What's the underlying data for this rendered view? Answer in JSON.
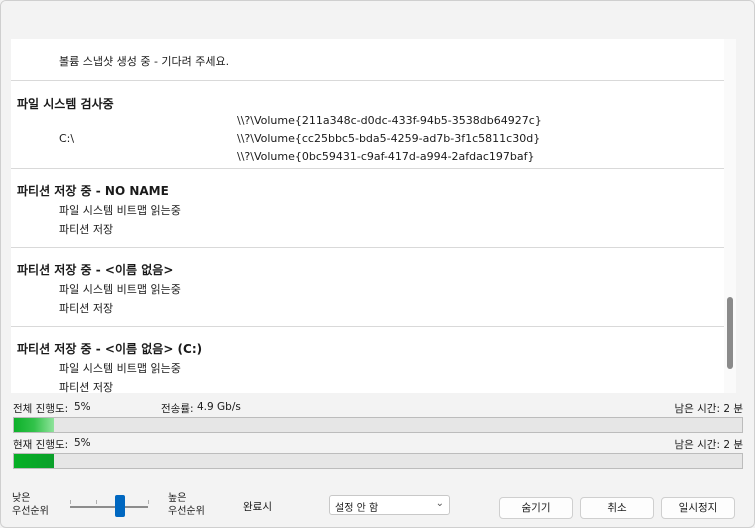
{
  "log": {
    "sections": [
      {
        "title": "",
        "lines": [
          "볼륨 스냅샷 생성 중 - 기다려 주세요."
        ]
      },
      {
        "title": "파일 시스템 검사중",
        "drive": "C:\\",
        "volumes": [
          "\\\\?\\Volume{211a348c-d0dc-433f-94b5-3538db64927c}",
          "\\\\?\\Volume{cc25bbc5-bda5-4259-ad7b-3f1c5811c30d}",
          "\\\\?\\Volume{0bc59431-c9af-417d-a994-2afdac197baf}"
        ]
      },
      {
        "title": "파티션 저장 중 - NO NAME",
        "lines": [
          "파일 시스템 비트맵 읽는중",
          "파티션 저장"
        ]
      },
      {
        "title": "파티션 저장 중 - <이름 없음>",
        "lines": [
          "파일 시스템 비트맵 읽는중",
          "파티션 저장"
        ]
      },
      {
        "title": "파티션 저장 중 - <이름 없음> (C:)",
        "lines": [
          "파일 시스템 비트맵 읽는중",
          "파티션 저장"
        ]
      }
    ]
  },
  "progress": {
    "overall_label": "전체 진행도:",
    "overall_value": "5%",
    "overall_fraction": 0.055,
    "rate_label": "전송률:",
    "rate_value": "4.9 Gb/s",
    "overall_remaining": "남은 시간: 2 분",
    "current_label": "현재 진행도:",
    "current_value": "5%",
    "current_fraction": 0.055,
    "current_remaining": "남은 시간: 2 분"
  },
  "priority": {
    "low_label_1": "낮은",
    "low_label_2": "우선순위",
    "high_label_1": "높은",
    "high_label_2": "우선순위"
  },
  "completion": {
    "label": "완료시",
    "selected": "설정 안 함"
  },
  "buttons": {
    "hide": "숨기기",
    "cancel": "취소",
    "pause": "일시정지"
  },
  "colors": {
    "progress": "#06b025",
    "accent": "#0067c0"
  }
}
